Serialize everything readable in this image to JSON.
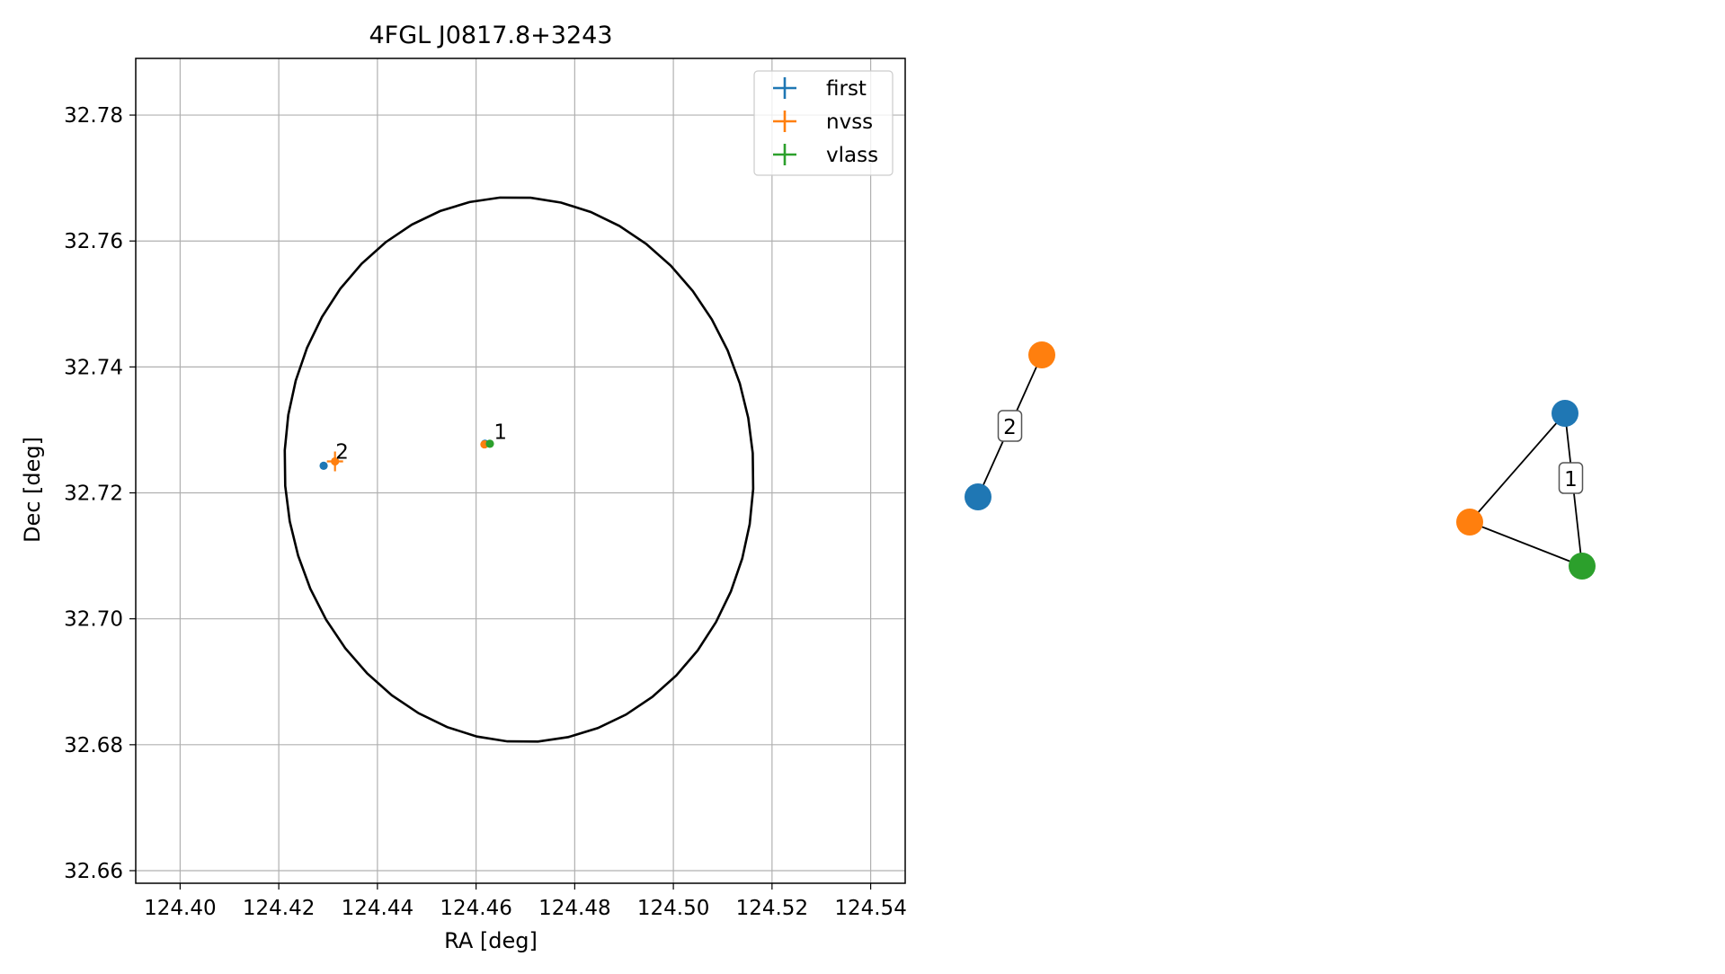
{
  "chart_data": {
    "type": "scatter",
    "title": "4FGL J0817.8+3243",
    "xlabel": "RA [deg]",
    "ylabel": "Dec [deg]",
    "xlim": [
      124.391,
      124.547
    ],
    "ylim": [
      32.658,
      32.789
    ],
    "xticks": [
      "124.40",
      "124.42",
      "124.44",
      "124.46",
      "124.48",
      "124.50",
      "124.52",
      "124.54"
    ],
    "yticks": [
      "32.66",
      "32.68",
      "32.70",
      "32.72",
      "32.74",
      "32.76",
      "32.78"
    ],
    "grid": true,
    "legend_position": "upper-right",
    "series": [
      {
        "name": "first",
        "color": "#1f77b4",
        "points": [
          {
            "x": 124.4291,
            "y": 32.7243
          },
          {
            "x": 124.4618,
            "y": 32.7278
          }
        ]
      },
      {
        "name": "nvss",
        "color": "#ff7f0e",
        "points": [
          {
            "x": 124.4314,
            "y": 32.725
          },
          {
            "x": 124.4617,
            "y": 32.7277
          }
        ]
      },
      {
        "name": "vlass",
        "color": "#2ca02c",
        "points": [
          {
            "x": 124.4628,
            "y": 32.7278
          }
        ]
      }
    ],
    "ellipse": {
      "center_ra": 124.4687,
      "center_dec": 32.7237,
      "semi_ra": 0.0475,
      "semi_dec": 0.0433,
      "angle_deg": -4,
      "color": "#000000"
    },
    "annotations": [
      {
        "text": "1",
        "x": 124.4636,
        "y": 32.7286
      },
      {
        "text": "2",
        "x": 124.4315,
        "y": 32.7254
      }
    ]
  },
  "graphs": [
    {
      "label": "2",
      "nodes": [
        {
          "series": "first",
          "color": "#1f77b4"
        },
        {
          "series": "nvss",
          "color": "#ff7f0e"
        }
      ],
      "edges": [
        [
          0,
          1
        ]
      ]
    },
    {
      "label": "1",
      "nodes": [
        {
          "series": "first",
          "color": "#1f77b4"
        },
        {
          "series": "nvss",
          "color": "#ff7f0e"
        },
        {
          "series": "vlass",
          "color": "#2ca02c"
        }
      ],
      "edges": [
        [
          0,
          1
        ],
        [
          1,
          2
        ],
        [
          0,
          2
        ]
      ]
    }
  ]
}
